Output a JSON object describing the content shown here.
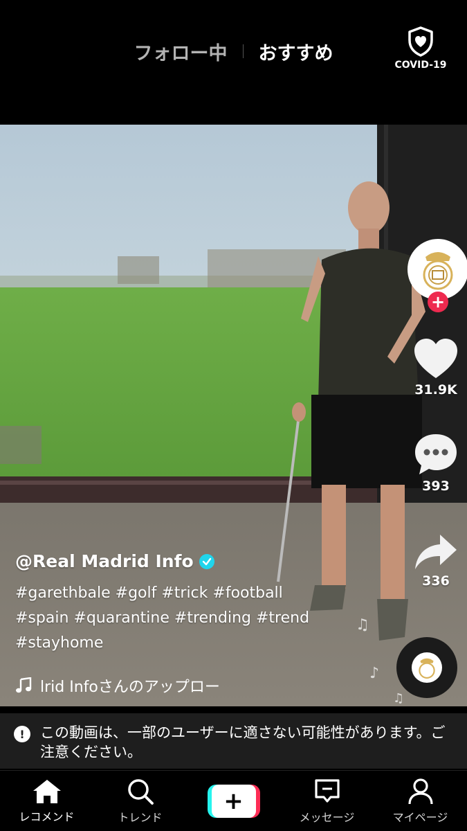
{
  "header": {
    "tab_following": "フォロー中",
    "tab_recommended": "おすすめ",
    "covid_label": "COVID-19"
  },
  "video": {
    "username": "@Real Madrid Info",
    "description": "#garethbale #golf #trick #football #spain #quarantine #trending #trend #stayhome",
    "sound": "lrid Infoさんのアップロー"
  },
  "actions": {
    "likes": "31.9K",
    "comments": "393",
    "shares": "336"
  },
  "warning": {
    "text": "この動画は、一部のユーザーに適さない可能性があります。ご注意ください。"
  },
  "nav": {
    "home": "レコメンド",
    "discover": "トレンド",
    "create": "+",
    "inbox": "メッセージ",
    "profile": "マイページ"
  },
  "colors": {
    "follow_plus": "#ee2a4f",
    "verified": "#20d5ec",
    "create_left": "#25f4ee",
    "create_right": "#fe2c55"
  }
}
